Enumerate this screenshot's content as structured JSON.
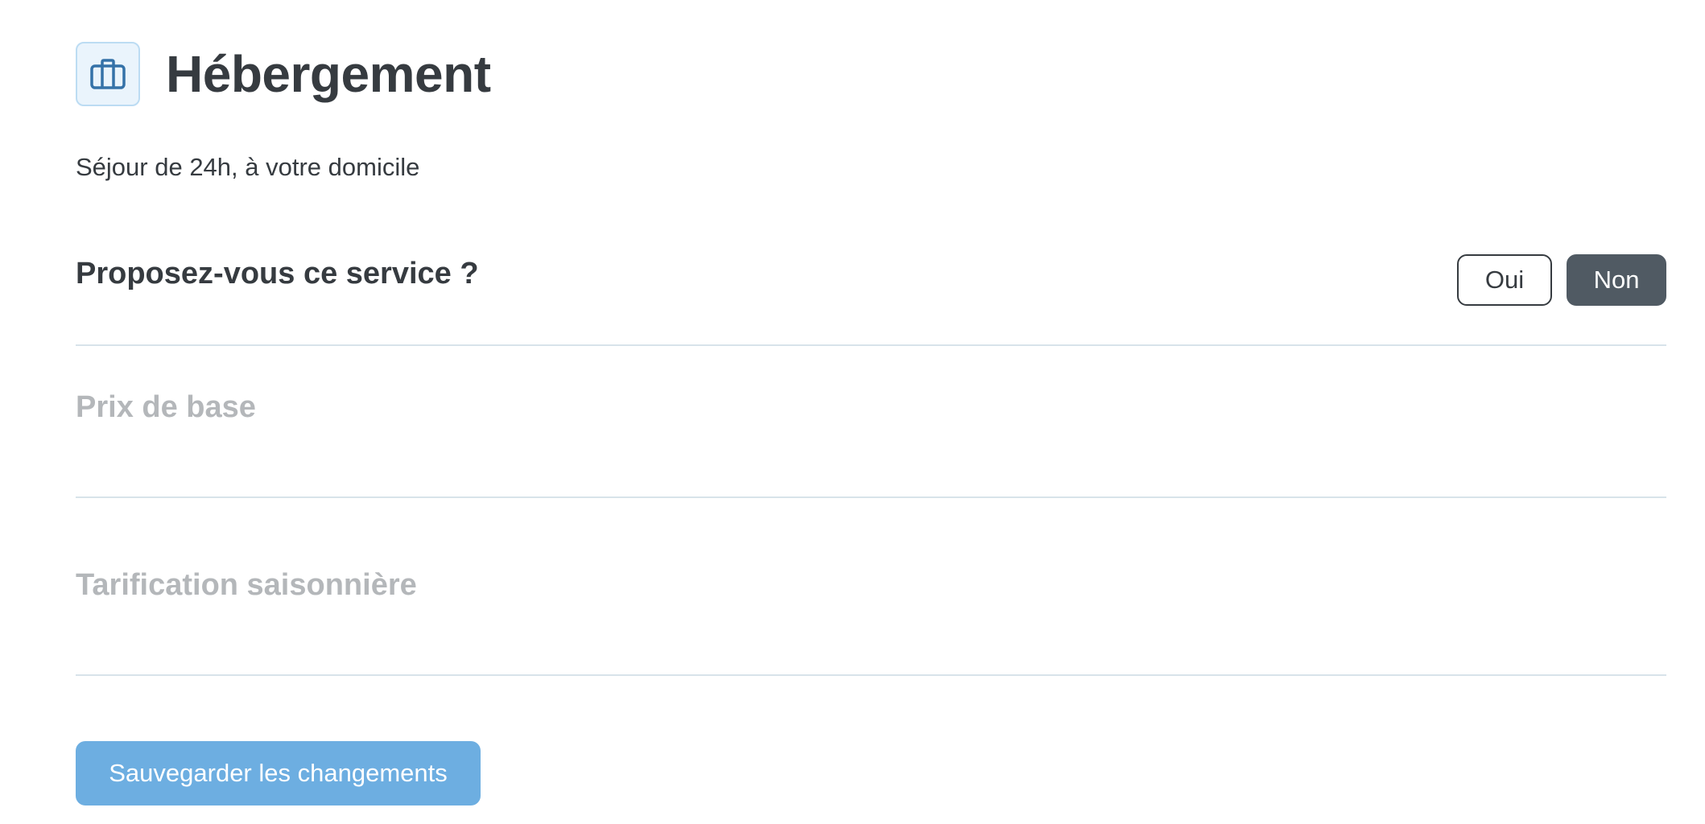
{
  "header": {
    "icon": "briefcase-icon",
    "title": "Hébergement"
  },
  "subtitle": "Séjour de 24h, à votre domicile",
  "service_question": {
    "label": "Proposez-vous ce service ?",
    "options": [
      "Oui",
      "Non"
    ],
    "selected": "Non"
  },
  "fields": {
    "base_price": {
      "label": "Prix de base"
    },
    "seasonal_pricing": {
      "label": "Tarification saisonnière"
    }
  },
  "save_button": {
    "label": "Sauvegarder les changements"
  },
  "colors": {
    "text": "#363b40",
    "disabled_text": "#b4b7ba",
    "icon_bg": "#eaf4fc",
    "icon_border": "#bcdcf3",
    "icon_stroke": "#3572a8",
    "selected_toggle": "#505a63",
    "primary_button": "#6daee1",
    "divider": "#d8e3ea"
  }
}
